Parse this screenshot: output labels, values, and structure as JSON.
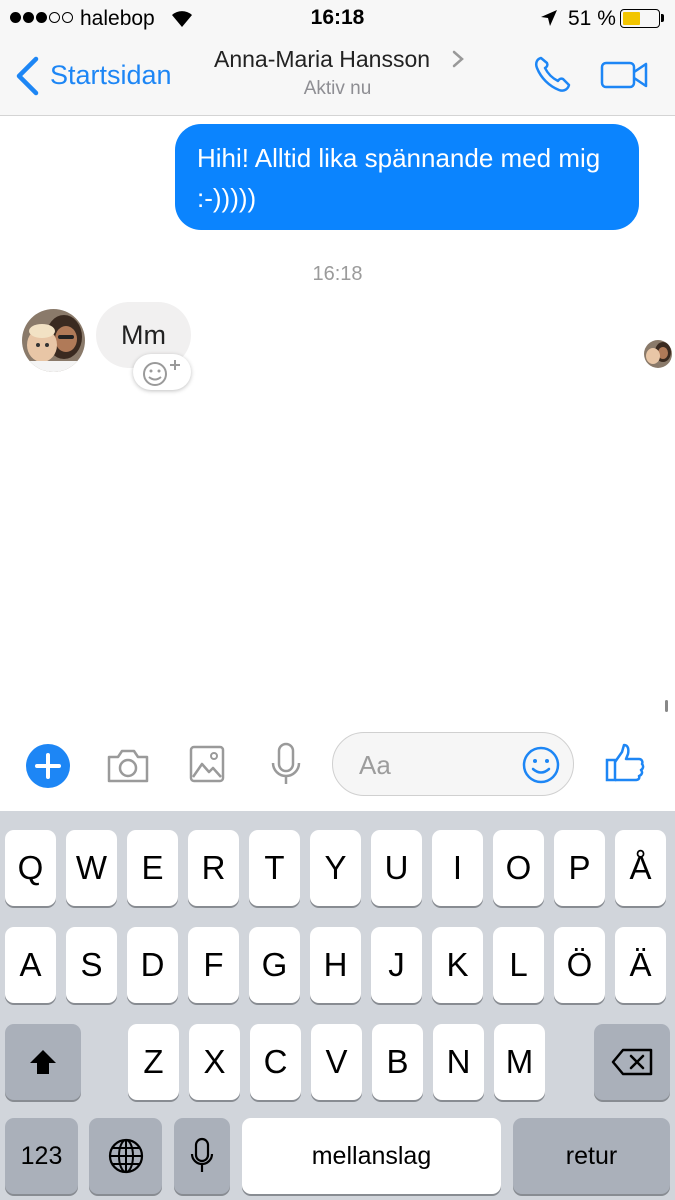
{
  "status_bar": {
    "carrier": "halebop",
    "time": "16:18",
    "battery_percent": "51 %",
    "battery_level": 0.51,
    "signal_bars": 3
  },
  "nav": {
    "back_label": "Startsidan",
    "contact_name": "Anna-Maria Hansson",
    "status": "Aktiv nu",
    "accent_color": "#1d86f5"
  },
  "messages": {
    "outgoing_text": "Hihi! Alltid lika spännande med mig :-)))))",
    "timestamp": "16:18",
    "incoming_text": "Mm"
  },
  "composer": {
    "placeholder": "Aa",
    "icons": [
      "plus-icon",
      "camera-icon",
      "image-icon",
      "microphone-icon",
      "smiley-icon",
      "thumbs-up-icon"
    ]
  },
  "keyboard": {
    "row1": [
      "Q",
      "W",
      "E",
      "R",
      "T",
      "Y",
      "U",
      "I",
      "O",
      "P",
      "Å"
    ],
    "row2": [
      "A",
      "S",
      "D",
      "F",
      "G",
      "H",
      "J",
      "K",
      "L",
      "Ö",
      "Ä"
    ],
    "row3": [
      "Z",
      "X",
      "C",
      "V",
      "B",
      "N",
      "M"
    ],
    "numbers_label": "123",
    "space_label": "mellanslag",
    "return_label": "retur"
  }
}
